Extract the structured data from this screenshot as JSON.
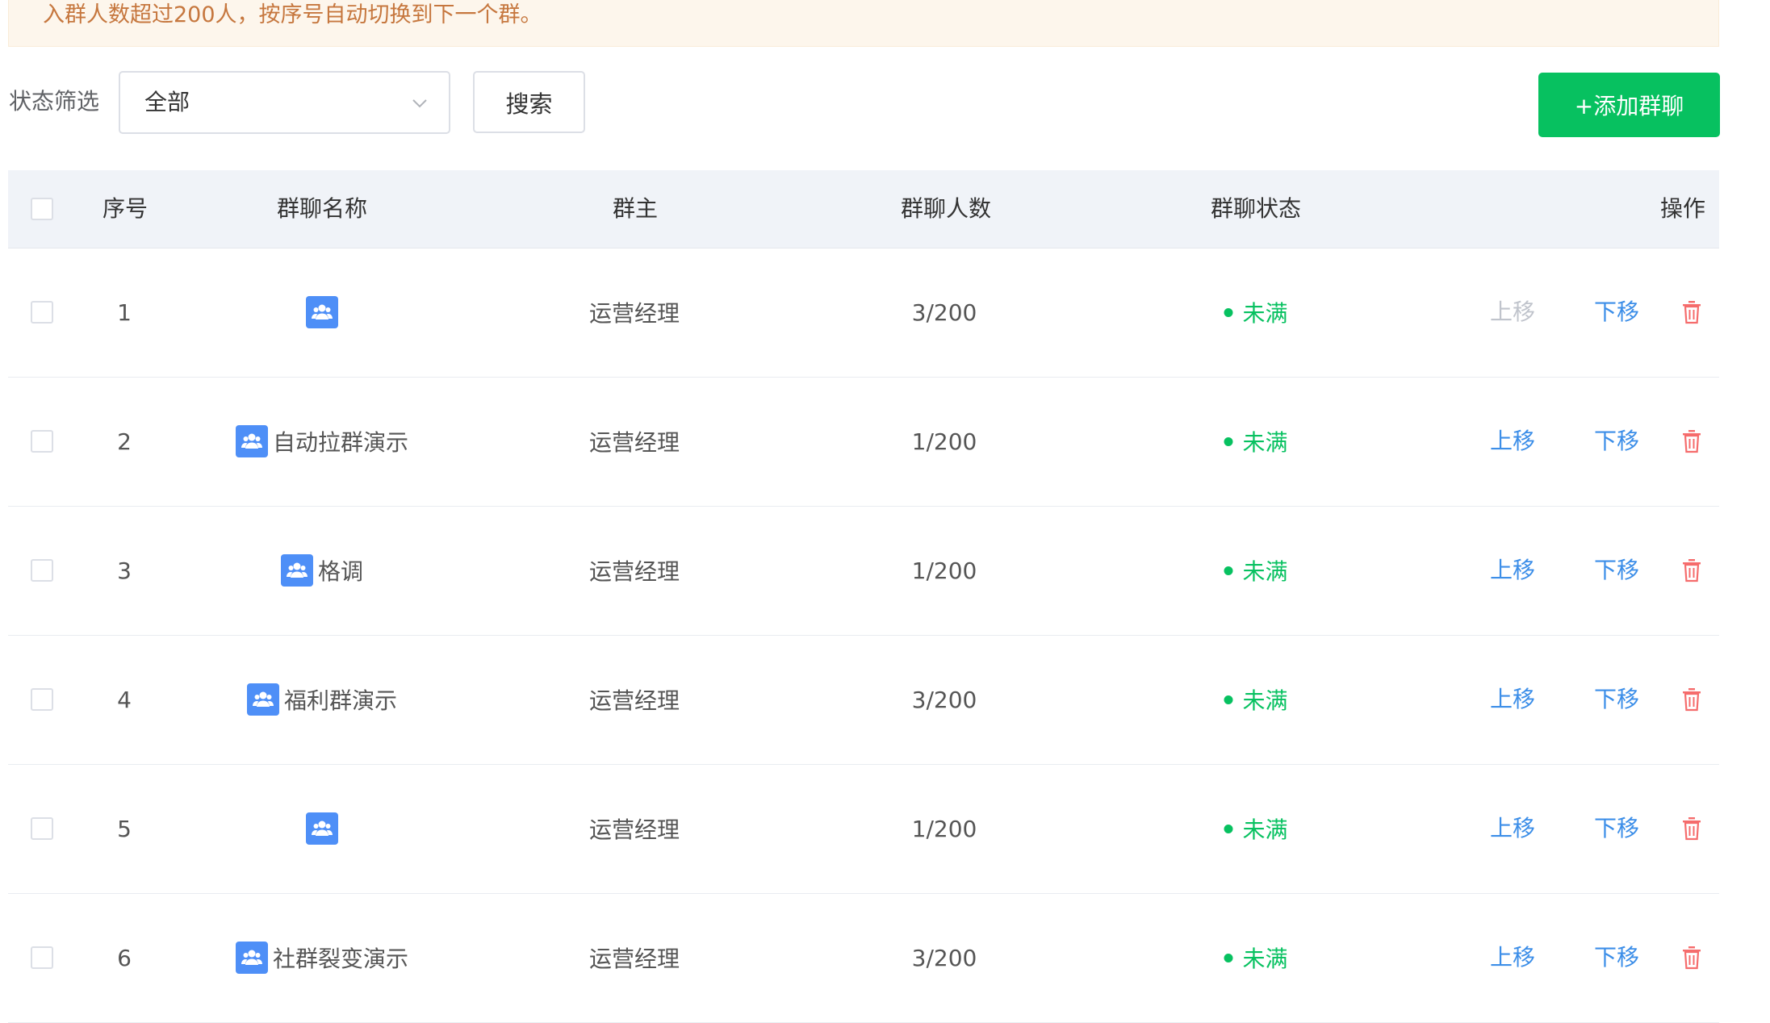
{
  "notice": {
    "text": "入群人数超过200人，按序号自动切换到下一个群。"
  },
  "filter": {
    "label": "状态筛选",
    "selected": "全部",
    "search_label": "搜索",
    "add_label": "+添加群聊"
  },
  "table": {
    "headers": {
      "index": "序号",
      "name": "群聊名称",
      "owner": "群主",
      "count": "群聊人数",
      "status": "群聊状态",
      "actions": "操作"
    },
    "rows": [
      {
        "index": "1",
        "name": "",
        "owner": "运营经理",
        "count": "3/200",
        "status": "未满",
        "up": "上移",
        "down": "下移",
        "up_disabled": true
      },
      {
        "index": "2",
        "name": "自动拉群演示",
        "owner": "运营经理",
        "count": "1/200",
        "status": "未满",
        "up": "上移",
        "down": "下移",
        "up_disabled": false
      },
      {
        "index": "3",
        "name": "格调",
        "owner": "运营经理",
        "count": "1/200",
        "status": "未满",
        "up": "上移",
        "down": "下移",
        "up_disabled": false
      },
      {
        "index": "4",
        "name": "福利群演示",
        "owner": "运营经理",
        "count": "3/200",
        "status": "未满",
        "up": "上移",
        "down": "下移",
        "up_disabled": false
      },
      {
        "index": "5",
        "name": "",
        "owner": "运营经理",
        "count": "1/200",
        "status": "未满",
        "up": "上移",
        "down": "下移",
        "up_disabled": false
      },
      {
        "index": "6",
        "name": "社群裂变演示",
        "owner": "运营经理",
        "count": "3/200",
        "status": "未满",
        "up": "上移",
        "down": "下移",
        "up_disabled": false
      }
    ]
  },
  "colors": {
    "accent_green": "#07c160",
    "link_blue": "#3c8ee8",
    "delete_red": "#f56c6c",
    "icon_blue": "#4e8ff7",
    "notice_bg": "#fdf6ec"
  },
  "icons": {
    "group": "group-chat-icon",
    "delete": "trash-icon",
    "dropdown": "chevron-down-icon"
  }
}
